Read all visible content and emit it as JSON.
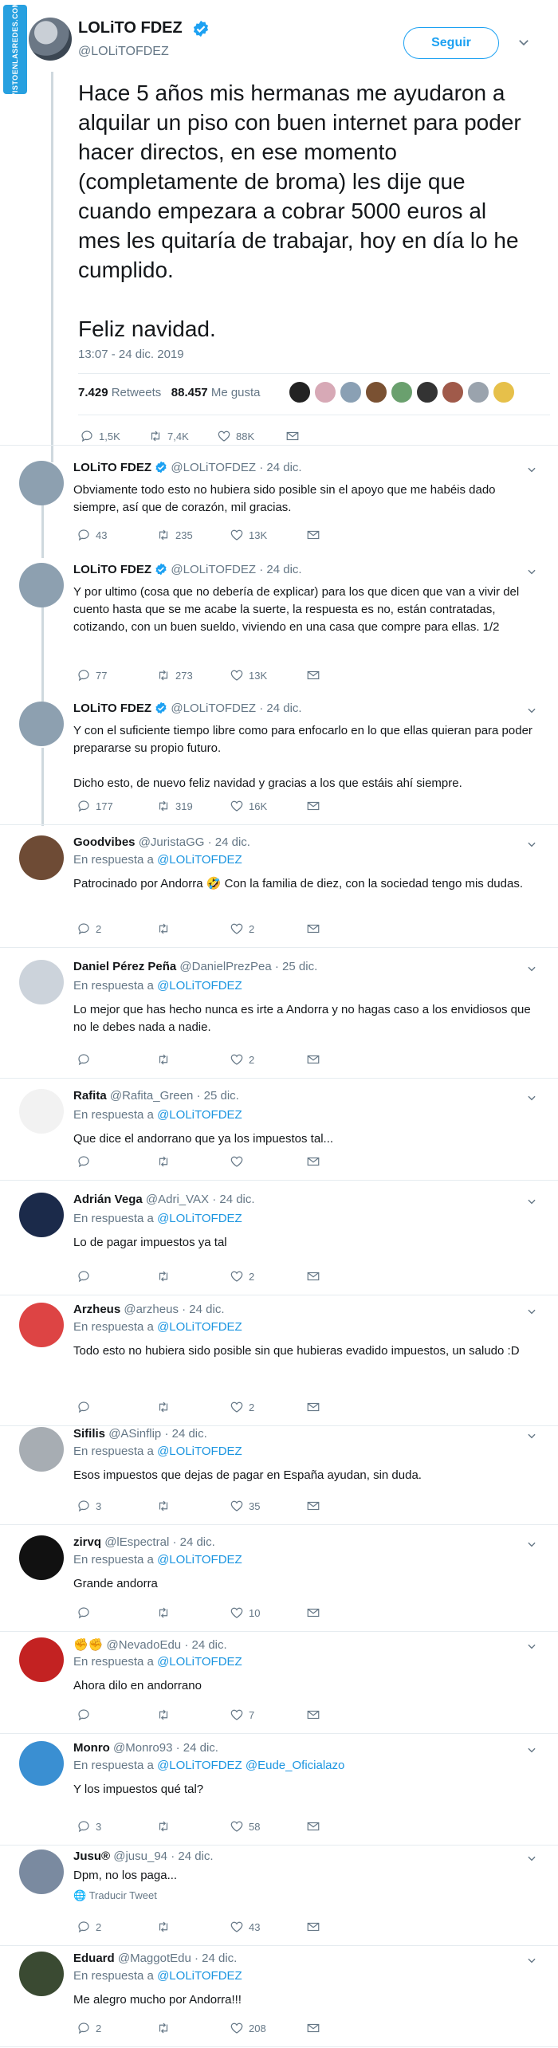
{
  "watermark": "VISTOENLASREDES.COM",
  "main": {
    "name": "LOLiTO FDEZ",
    "handle": "@LOLiTOFDEZ",
    "follow_label": "Seguir",
    "text": "Hace 5 años mis hermanas me ayudaron a alquilar un piso con buen internet para poder hacer directos, en ese momento (completamente de broma) les dije que cuando empezara a cobrar 5000 euros al mes les quitaría de trabajar, hoy en día lo he cumplido.\n\nFeliz navidad.",
    "time": "13:07 - 24 dic. 2019",
    "retweets_count": "7.429",
    "retweets_label": "Retweets",
    "likes_count": "88.457",
    "likes_label": "Me gusta",
    "replies": "1,5K",
    "rts": "7,4K",
    "likes": "88K"
  },
  "colors": {
    "accent": "#1da1f2",
    "link": "#1b95e0",
    "muted": "#657786"
  },
  "replies": [
    {
      "name": "LOLiTO FDEZ",
      "verified": true,
      "handle": "@LOLiTOFDEZ",
      "date": "· 24 dic.",
      "in_reply": "",
      "in_reply_prefix": "",
      "text": "Obviamente todo esto no hubiera sido posible sin el apoyo que me habéis dado siempre, así que de corazón, mil gracias.",
      "replies": "43",
      "rts": "235",
      "likes": "13K"
    },
    {
      "name": "LOLiTO FDEZ",
      "verified": true,
      "handle": "@LOLiTOFDEZ",
      "date": "· 24 dic.",
      "in_reply": "",
      "in_reply_prefix": "",
      "text": "Y por ultimo (cosa que no debería de explicar) para los que dicen que van a vivir del cuento hasta que se me acabe la suerte, la respuesta es no, están contratadas, cotizando, con un buen sueldo, viviendo en una casa que compre para ellas. 1/2",
      "replies": "77",
      "rts": "273",
      "likes": "13K"
    },
    {
      "name": "LOLiTO FDEZ",
      "verified": true,
      "handle": "@LOLiTOFDEZ",
      "date": "· 24 dic.",
      "in_reply": "",
      "in_reply_prefix": "",
      "text": "Y con el suficiente tiempo libre como para enfocarlo en lo que ellas quieran para poder prepararse su propio futuro.\n\nDicho esto, de nuevo feliz navidad y gracias a los que estáis ahí siempre.",
      "replies": "177",
      "rts": "319",
      "likes": "16K"
    },
    {
      "name": "Goodvibes",
      "handle": "@JuristaGG",
      "date": "· 24 dic.",
      "in_reply_prefix": "En respuesta a",
      "in_reply": "@LOLiTOFDEZ",
      "text": "Patrocinado por Andorra 🤣 Con la familia de diez, con la sociedad tengo mis dudas.",
      "replies": "2",
      "rts": "",
      "likes": "2"
    },
    {
      "name": "Daniel Pérez Peña",
      "handle": "@DanielPrezPea",
      "date": "· 25 dic.",
      "in_reply_prefix": "En respuesta a",
      "in_reply": "@LOLiTOFDEZ",
      "text": "Lo mejor que has hecho nunca es irte a Andorra y no hagas caso a los envidiosos que no le debes nada a nadie.",
      "replies": "",
      "rts": "",
      "likes": "2"
    },
    {
      "name": "Rafita",
      "handle": "@Rafita_Green",
      "date": "· 25 dic.",
      "in_reply_prefix": "En respuesta a",
      "in_reply": "@LOLiTOFDEZ",
      "text": "Que dice el andorrano que ya los impuestos tal...",
      "replies": "",
      "rts": "",
      "likes": ""
    },
    {
      "name": "Adrián Vega",
      "handle": "@Adri_VAX",
      "date": "· 24 dic.",
      "in_reply_prefix": "En respuesta a",
      "in_reply": "@LOLiTOFDEZ",
      "text": "Lo de pagar impuestos ya tal",
      "replies": "",
      "rts": "",
      "likes": "2"
    },
    {
      "name": "Arzheus",
      "handle": "@arzheus",
      "date": "· 24 dic.",
      "in_reply_prefix": "En respuesta a",
      "in_reply": "@LOLiTOFDEZ",
      "text": "Todo esto no hubiera sido posible sin que hubieras evadido impuestos, un saludo :D",
      "replies": "",
      "rts": "",
      "likes": "2"
    },
    {
      "name": "Sifilis",
      "handle": "@ASinflip",
      "date": "· 24 dic.",
      "in_reply_prefix": "En respuesta a",
      "in_reply": "@LOLiTOFDEZ",
      "text": "Esos impuestos que dejas de pagar en España ayudan, sin duda.",
      "replies": "3",
      "rts": "",
      "likes": "35"
    },
    {
      "name": "zirvq",
      "handle": "@lEspectral",
      "date": "· 24 dic.",
      "in_reply_prefix": "En respuesta a",
      "in_reply": "@LOLiTOFDEZ",
      "text": "Grande andorra",
      "replies": "",
      "rts": "",
      "likes": "10"
    },
    {
      "name": "✊✊",
      "handle": "@NevadoEdu",
      "date": "· 24 dic.",
      "in_reply_prefix": "En respuesta a",
      "in_reply": "@LOLiTOFDEZ",
      "text": "Ahora dilo en andorrano",
      "replies": "",
      "rts": "",
      "likes": "7"
    },
    {
      "name": "Monro",
      "handle": "@Monro93",
      "date": "· 24 dic.",
      "in_reply_prefix": "En respuesta a",
      "in_reply": "@LOLiTOFDEZ @Eude_Oficialazo",
      "text": "Y los impuestos qué tal?",
      "replies": "3",
      "rts": "",
      "likes": "58"
    },
    {
      "name": "Jusu®",
      "handle": "@jusu_94",
      "date": "· 24 dic.",
      "in_reply_prefix": "",
      "in_reply": "",
      "text": "Dpm, no los paga...",
      "translate": "Traducir Tweet",
      "replies": "2",
      "rts": "",
      "likes": "43"
    },
    {
      "name": "Eduard",
      "handle": "@MaggotEdu",
      "date": "· 24 dic.",
      "in_reply_prefix": "En respuesta a",
      "in_reply": "@LOLiTOFDEZ",
      "text": "Me alegro mucho por Andorra!!!",
      "replies": "2",
      "rts": "",
      "likes": "208"
    }
  ]
}
